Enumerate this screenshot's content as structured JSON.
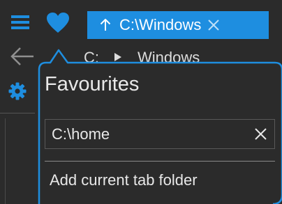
{
  "topbar": {
    "menu_icon": "hamburger-menu-icon",
    "favourites_icon": "heart-icon"
  },
  "tab": {
    "up_icon": "arrow-up-icon",
    "label": "C:\\Windows",
    "close_icon": "close-icon"
  },
  "navrow": {
    "back_icon": "arrow-left-icon",
    "crumb_drive": "C:",
    "crumb_separator_icon": "triangle-right-icon",
    "crumb_folder": "Windows"
  },
  "sidebar": {
    "settings_icon": "gear-icon"
  },
  "popup": {
    "title": "Favourites",
    "favourite_value": "C:\\home",
    "remove_icon": "close-icon",
    "add_current": "Add current tab folder"
  },
  "colors": {
    "accent": "#1e8ee0",
    "background": "#2b2b2b",
    "text": "#e8e8e8"
  }
}
